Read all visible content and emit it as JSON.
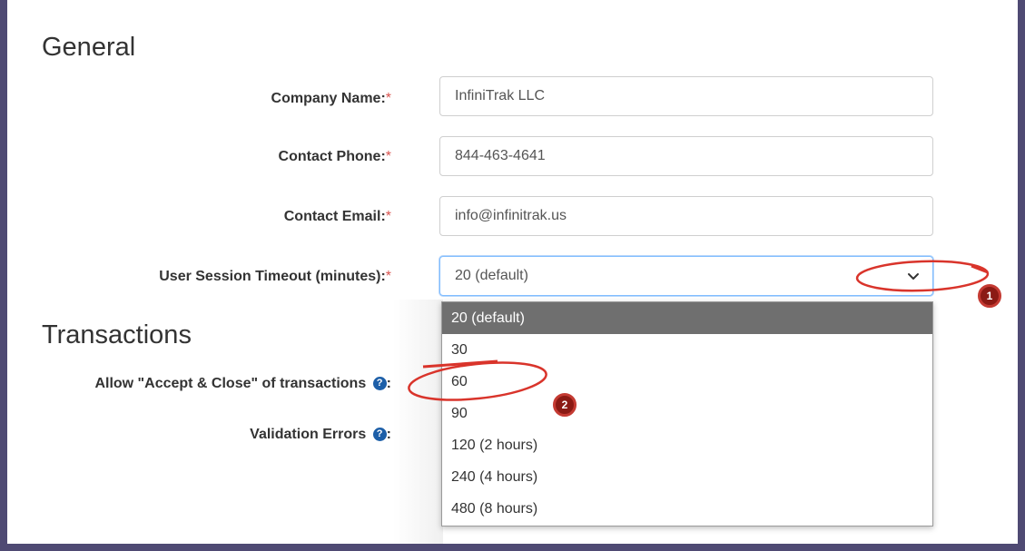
{
  "sections": {
    "general": "General",
    "transactions": "Transactions"
  },
  "form": {
    "company_name": {
      "label": "Company Name:",
      "required": "*",
      "value": "InfiniTrak LLC"
    },
    "contact_phone": {
      "label": "Contact Phone:",
      "required": "*",
      "value": "844-463-4641"
    },
    "contact_email": {
      "label": "Contact Email:",
      "required": "*",
      "value": "info@infinitrak.us"
    },
    "session_timeout": {
      "label": "User Session Timeout (minutes):",
      "required": "*",
      "value": "20 (default)"
    },
    "accept_close": {
      "label": "Allow \"Accept & Close\" of transactions",
      "suffix": ":"
    },
    "validation_errors": {
      "label": "Validation Errors",
      "suffix": ":"
    }
  },
  "dropdown": {
    "options": [
      "20 (default)",
      "30",
      "60",
      "90",
      "120 (2 hours)",
      "240 (4 hours)",
      "480 (8 hours)"
    ],
    "selected_index": 0
  },
  "annotations": {
    "badge_1": "1",
    "badge_2": "2",
    "color": "#d9342b"
  },
  "icons": {
    "help": "?",
    "chevron": "chevron-down-icon"
  }
}
